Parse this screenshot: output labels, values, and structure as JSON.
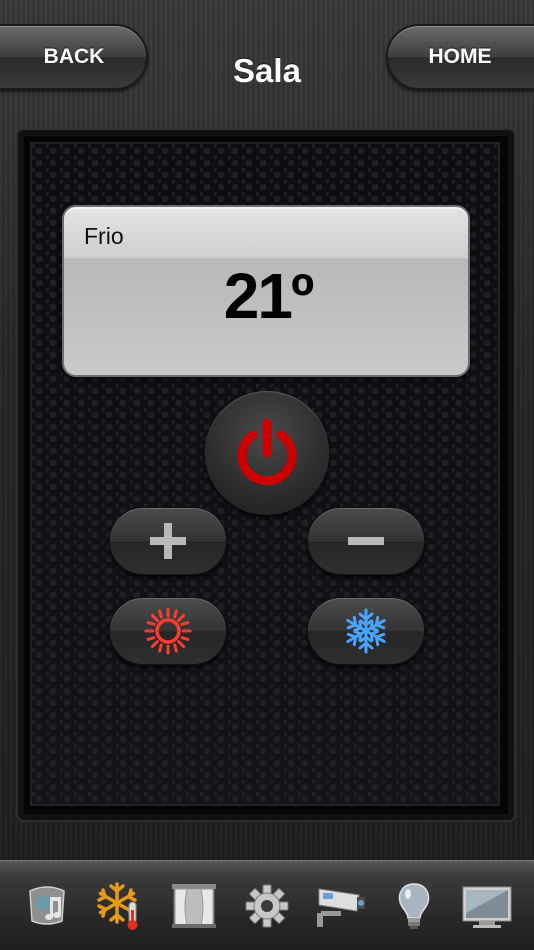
{
  "header": {
    "back_label": "BACK",
    "home_label": "HOME",
    "title": "Sala"
  },
  "display": {
    "mode": "Frio",
    "temperature": "21º"
  },
  "controls": {
    "power_icon": "power-icon",
    "increase_icon": "plus-icon",
    "decrease_icon": "minus-icon",
    "heat_icon": "sun-icon",
    "cool_icon": "snowflake-icon"
  },
  "bottom_nav": {
    "items": [
      "music-icon",
      "climate-icon",
      "curtain-icon",
      "gear-icon",
      "camera-icon",
      "bulb-icon",
      "tv-icon"
    ],
    "active": "climate-icon"
  },
  "colors": {
    "power": "#cc0000",
    "heat": "#ff3b30",
    "cool": "#4aa3ff"
  }
}
